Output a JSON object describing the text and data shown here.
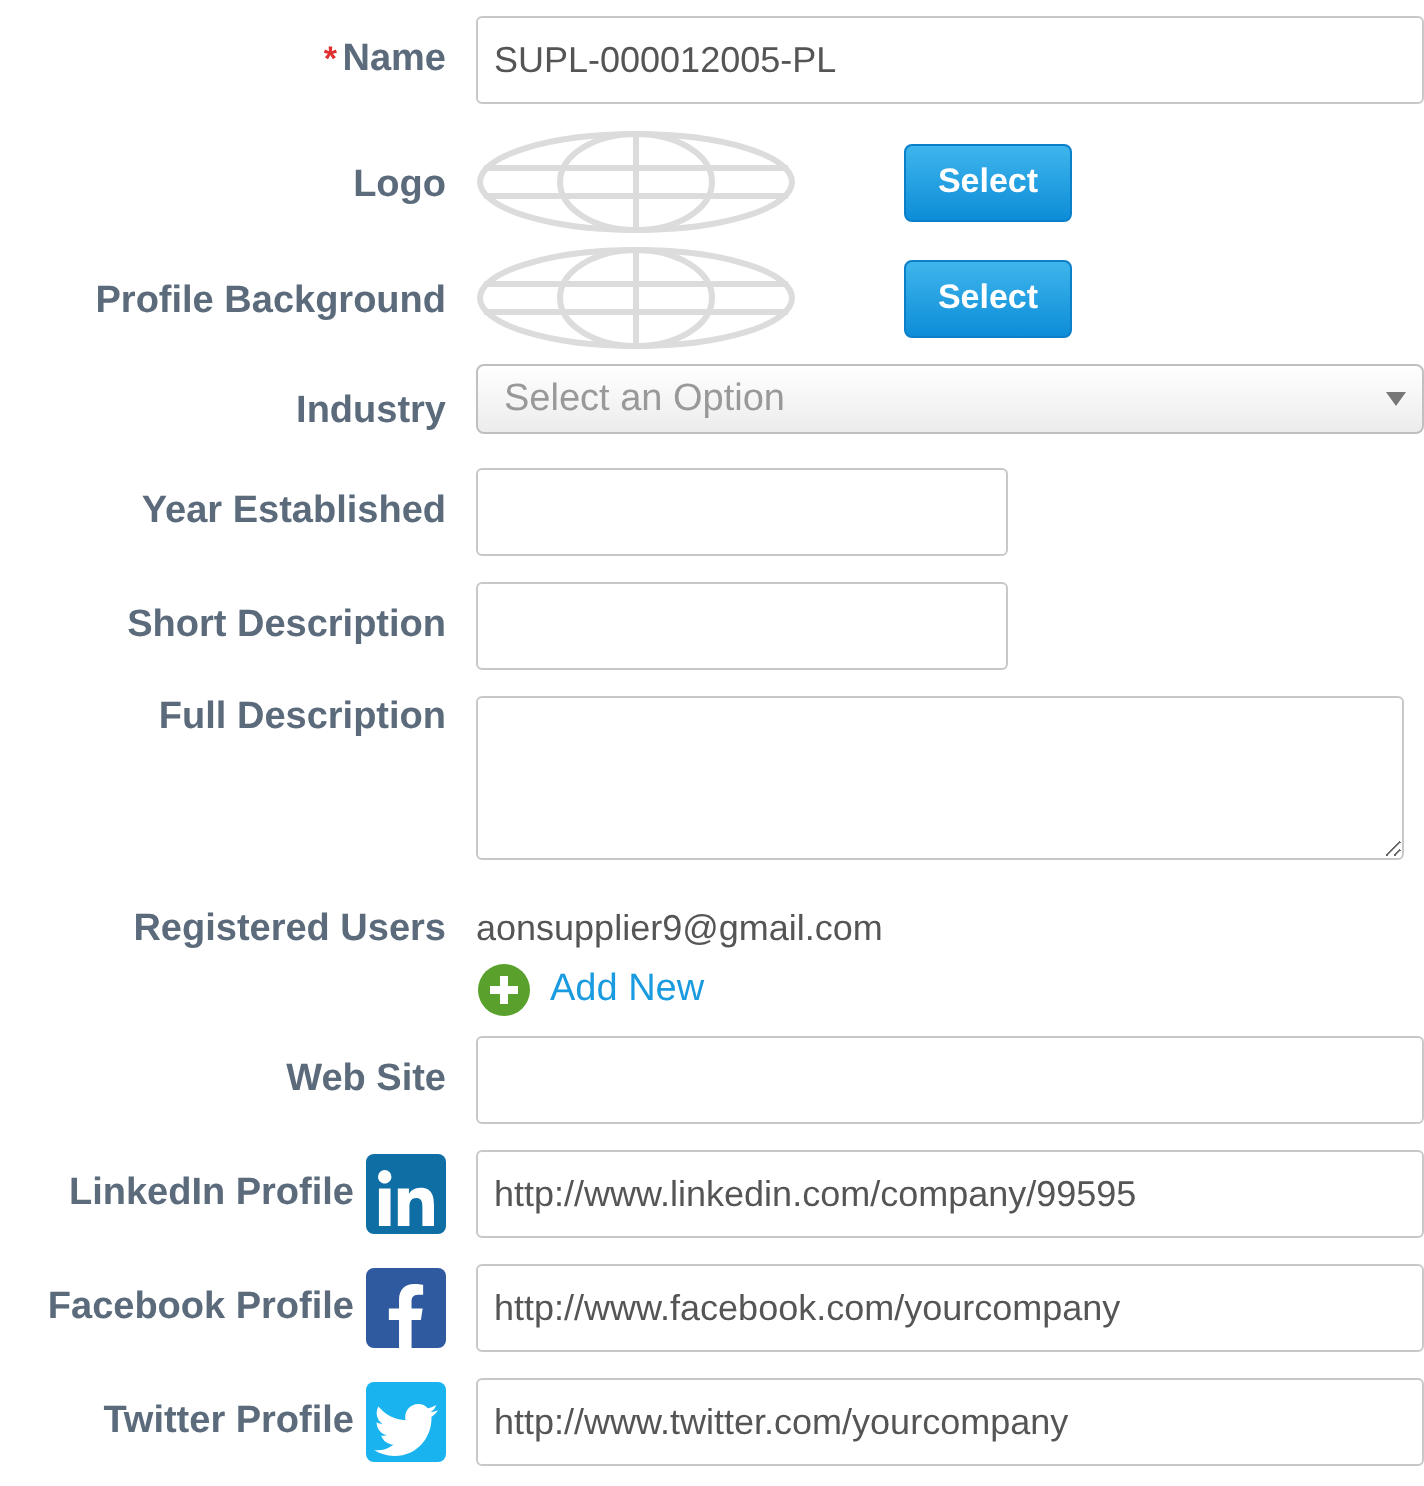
{
  "fields": [
    {
      "kind": "text",
      "label": "Name",
      "marker": "*",
      "value": "SUPL-000012005-PL"
    },
    {
      "kind": "image",
      "label": "Logo",
      "button": "Select"
    },
    {
      "kind": "image",
      "label": "Profile Background",
      "button": "Select"
    },
    {
      "kind": "select",
      "label": "Industry",
      "placeholder": "Select an Option"
    },
    {
      "kind": "short",
      "label": "Year Established"
    },
    {
      "kind": "short",
      "label": "Short Description"
    },
    {
      "kind": "textarea",
      "label": "Full Description"
    },
    {
      "kind": "users",
      "label": "Registered Users",
      "users": [
        "aonsupplier9@gmail.com"
      ],
      "add_label": "Add New"
    },
    {
      "kind": "text",
      "label": "Web Site"
    },
    {
      "kind": "linkedin",
      "label": "LinkedIn Profile",
      "value": "http://www.linkedin.com/company/99595"
    },
    {
      "kind": "facebook",
      "label": "Facebook Profile",
      "value": "http://www.facebook.com/yourcompany"
    },
    {
      "kind": "twitter",
      "label": "Twitter Profile",
      "value": "http://www.twitter.com/yourcompany"
    }
  ]
}
